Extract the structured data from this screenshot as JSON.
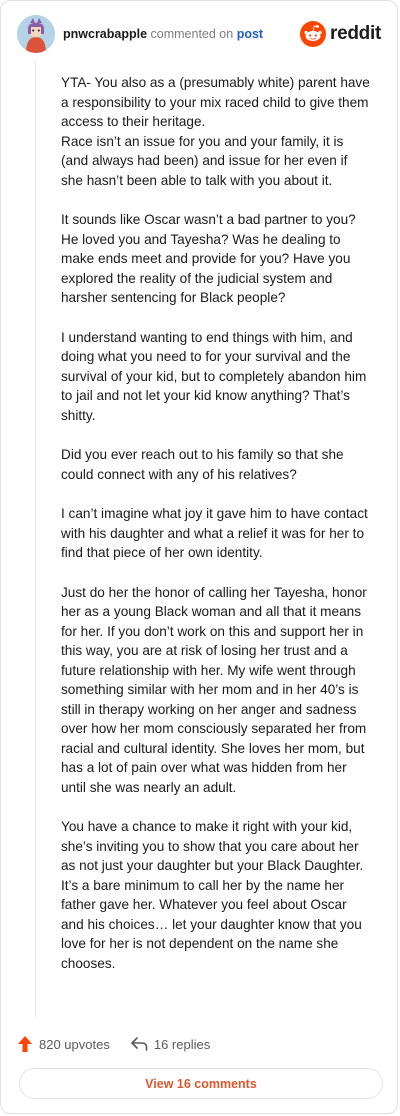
{
  "header": {
    "username": "pnwcrabapple",
    "action": "commented on",
    "target": "post",
    "brand": "reddit",
    "avatar_color": "#b4d3e6"
  },
  "comment": {
    "p1_line1": "YTA- You also as a (presumably white) parent have a responsibility to your mix raced child to give them access to their heritage.",
    "p1_line2": "Race isn’t an issue for you and your family, it is (and always had been) and issue for her even if she hasn’t been able to talk with you about it.",
    "p2": "It sounds like Oscar wasn’t a bad partner to you? He loved you and Tayesha? Was he dealing to make ends meet and provide for you? Have you explored the reality of the judicial system and harsher sentencing for Black people?",
    "p3": "I understand wanting to end things with him, and doing what you need to for your survival and the survival of your kid, but to completely abandon him to jail and not let your kid know anything? That’s shitty.",
    "p4": "Did you ever reach out to his family so that she could connect with any of his relatives?",
    "p5": "I can’t imagine what joy it gave him to have contact with his daughter and what a relief it was for her to find that piece of her own identity.",
    "p6": "Just do her the honor of calling her Tayesha, honor her as a young Black woman and all that it means for her. If you don’t work on this and support her in this way, you are at risk of losing her trust and a future relationship with her. My wife went through something similar with her mom and in her 40’s is still in therapy working on her anger and sadness over how her mom consciously separated her from racial and cultural identity. She loves her mom, but has a lot of pain over what was hidden from her until she was nearly an adult.",
    "p7": "You have a chance to make it right with your kid, she’s inviting you to show that you care about her as not just your daughter but your Black Daughter. It’s a bare minimum to call her by the name her father gave her. Whatever you feel about Oscar and his choices… let your daughter know that you love for her is not dependent on the name she chooses."
  },
  "footer": {
    "upvotes": "820 upvotes",
    "replies": "16 replies",
    "view_comments": "View 16 comments",
    "upvote_color": "#ff4500",
    "accent_color": "#e0562b"
  },
  "icons": {
    "upvote": "upvote-arrow-icon",
    "reply": "reply-arrow-icon",
    "logo": "reddit-alien-icon"
  }
}
